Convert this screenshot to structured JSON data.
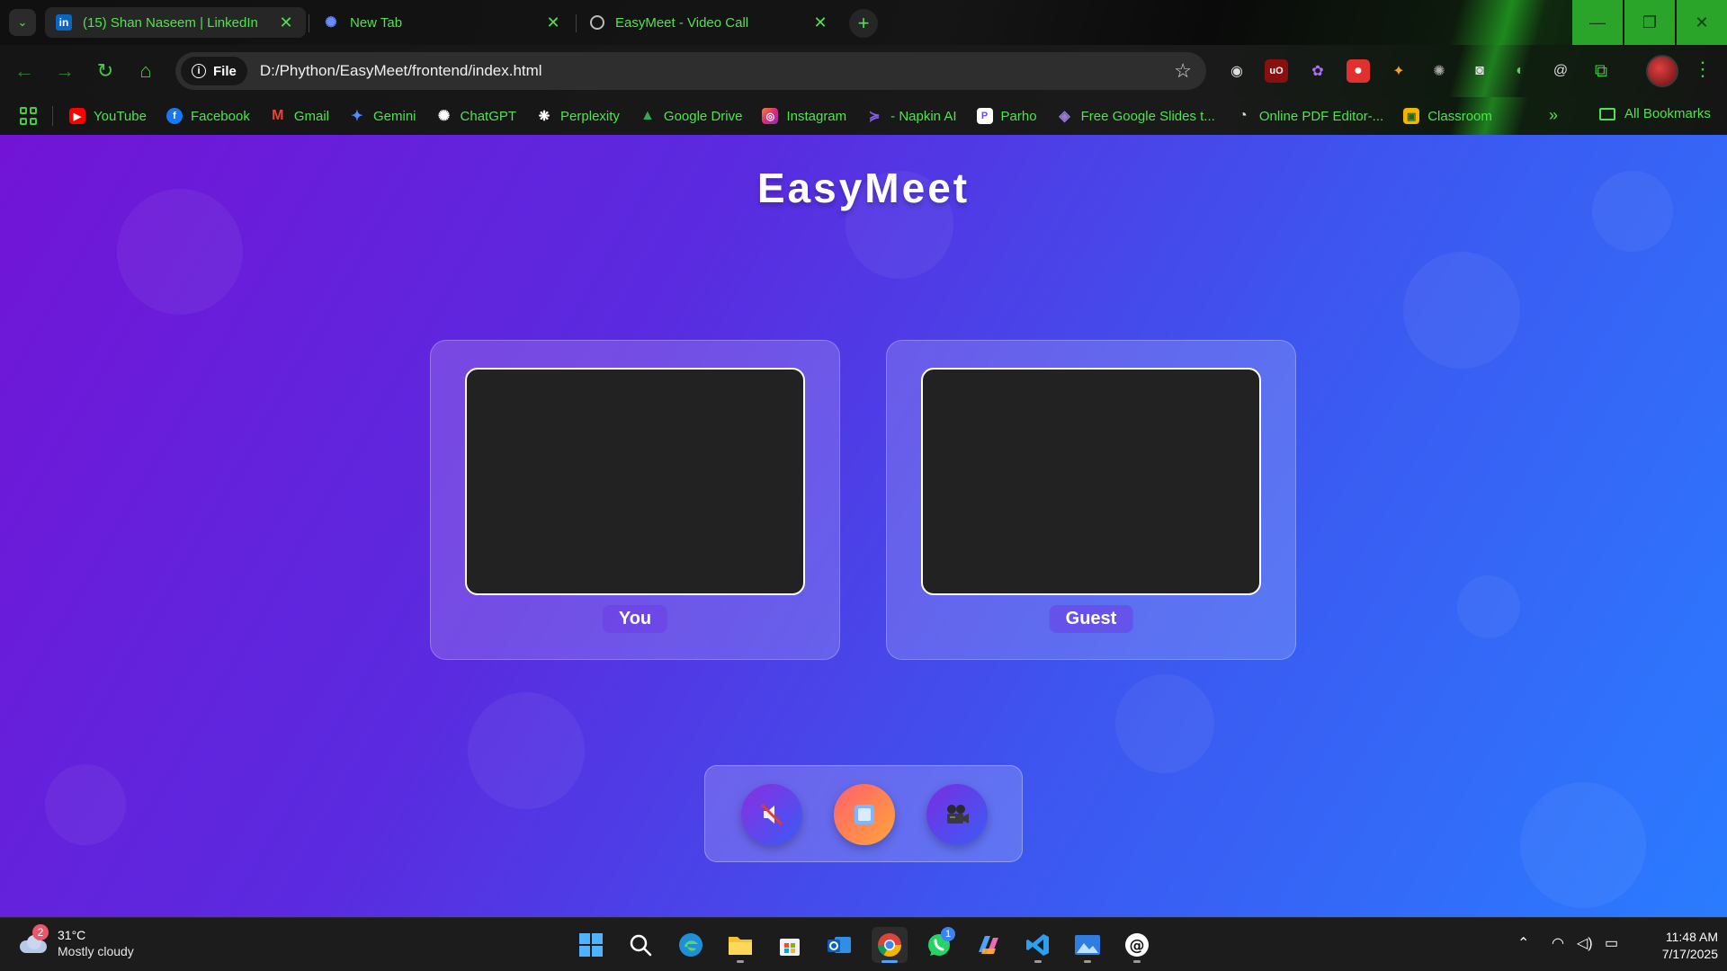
{
  "browser": {
    "tabs": [
      {
        "title": "(15) Shan Naseem | LinkedIn",
        "favicon": "linkedin-icon",
        "active": true
      },
      {
        "title": "New Tab",
        "favicon": "chatgpt-icon",
        "active": false
      },
      {
        "title": "EasyMeet - Video Call",
        "favicon": "globe-icon",
        "active": false
      }
    ],
    "omnibox": {
      "chip_label": "File",
      "url": "D:/Phython/EasyMeet/frontend/index.html"
    },
    "bookmarks": [
      {
        "label": "YouTube",
        "icon": "youtube-icon",
        "color": "#ff0000"
      },
      {
        "label": "Facebook",
        "icon": "facebook-icon",
        "color": "#1877f2"
      },
      {
        "label": "Gmail",
        "icon": "gmail-icon",
        "color": "#ea4335"
      },
      {
        "label": "Gemini",
        "icon": "gemini-icon",
        "color": "#4f8cff"
      },
      {
        "label": "ChatGPT",
        "icon": "chatgpt-icon",
        "color": "#ffffff"
      },
      {
        "label": "Perplexity",
        "icon": "perplexity-icon",
        "color": "#ffffff"
      },
      {
        "label": "Google Drive",
        "icon": "drive-icon",
        "color": "#34a853"
      },
      {
        "label": "Instagram",
        "icon": "instagram-icon",
        "color": "#e1306c"
      },
      {
        "label": "- Napkin AI",
        "icon": "napkin-icon",
        "color": "#8a5cf6"
      },
      {
        "label": "Parho",
        "icon": "parho-icon",
        "color": "#6b4cf6"
      },
      {
        "label": "Free Google Slides t...",
        "icon": "slides-icon",
        "color": "#9b7ad6"
      },
      {
        "label": "Online PDF Editor-...",
        "icon": "pdf-icon",
        "color": "#dddddd"
      },
      {
        "label": "Classroom",
        "icon": "classroom-icon",
        "color": "#f4b400"
      }
    ],
    "all_bookmarks_label": "All Bookmarks",
    "accent_color": "#4fe34f"
  },
  "page": {
    "title": "EasyMeet",
    "participants": [
      {
        "label": "You"
      },
      {
        "label": "Guest"
      }
    ],
    "controls": [
      {
        "name": "mute-button",
        "icon": "muted-speaker-icon"
      },
      {
        "name": "stop-button",
        "icon": "stop-icon"
      },
      {
        "name": "camera-button",
        "icon": "video-camera-icon"
      }
    ],
    "gradient_start": "#7214d6",
    "gradient_end": "#2a7cff"
  },
  "taskbar": {
    "weather": {
      "badge": "2",
      "temp": "31°C",
      "condition": "Mostly cloudy"
    },
    "whatsapp_badge": "1",
    "time": "11:48 AM",
    "date": "7/17/2025"
  }
}
